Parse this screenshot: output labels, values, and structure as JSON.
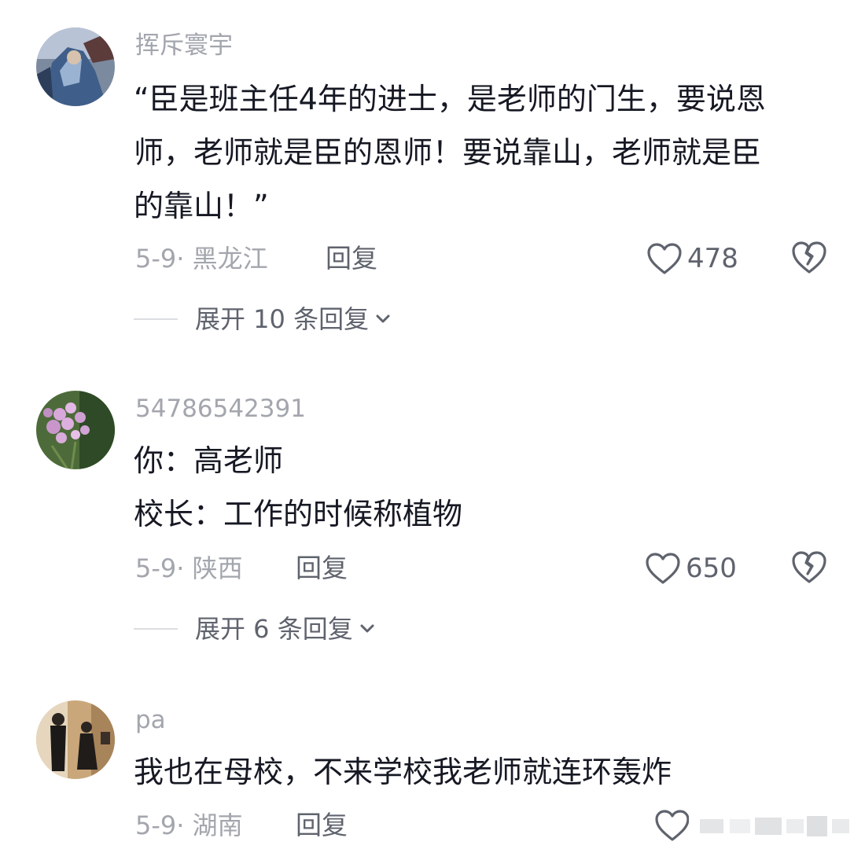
{
  "comments": [
    {
      "username": "挥斥寰宇",
      "lines": [
        "“臣是班主任4年的进士，是老师的门生，要说恩",
        "师，老师就是臣的恩师！要说靠山，老师就是臣",
        "的靠山！”"
      ],
      "meta": "5-9· 黑龙江",
      "reply_label": "回复",
      "likes": "478",
      "expand_label": "展开 10 条回复"
    },
    {
      "username": "54786542391",
      "lines": [
        "你：高老师",
        "校长：工作的时候称植物"
      ],
      "meta": "5-9· 陕西",
      "reply_label": "回复",
      "likes": "650",
      "expand_label": "展开 6 条回复"
    },
    {
      "username": "pa",
      "lines": [
        "我也在母校，不来学校我老师就连环轰炸"
      ],
      "meta": "5-9· 湖南",
      "reply_label": "回复"
    }
  ],
  "icons": {
    "like": "heart-outline-icon",
    "dislike": "broken-heart-icon",
    "expand": "chevron-down-icon"
  },
  "colors": {
    "text": "#161823",
    "secondary": "#a3a6ad",
    "action": "#5f636d"
  }
}
